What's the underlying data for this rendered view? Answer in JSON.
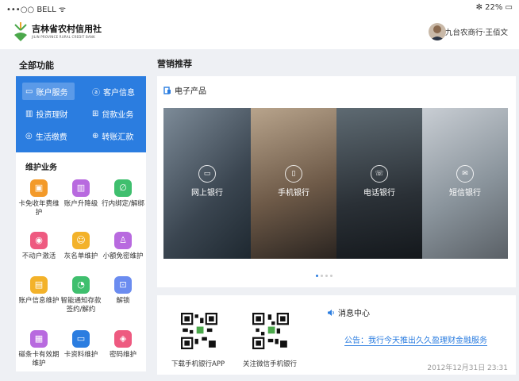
{
  "status": {
    "carrier": "•••○○ BELL ᯤ",
    "battery": "✻ 22% ▭"
  },
  "header": {
    "logo_cn": "吉林省农村信用社",
    "logo_en": "JILIN PROVINCE RURAL CREDIT BANK",
    "user_name": "九台农商行·王佰文"
  },
  "sidebar": {
    "title": "全部功能",
    "quick": [
      {
        "label": "账户服务",
        "icon": "▭"
      },
      {
        "label": "客户信息",
        "icon": "ⓐ"
      },
      {
        "label": "投资理财",
        "icon": "▥"
      },
      {
        "label": "贷款业务",
        "icon": "⊞"
      },
      {
        "label": "生活缴费",
        "icon": "◎"
      },
      {
        "label": "转账汇款",
        "icon": "⊕"
      }
    ],
    "maint_title": "维护业务",
    "items": [
      {
        "label": "卡免收年费维护",
        "icon": "▣",
        "color": "#f39a2a"
      },
      {
        "label": "账户升降级",
        "icon": "▥",
        "color": "#b86adf"
      },
      {
        "label": "行内绑定/解绑",
        "icon": "∅",
        "color": "#3fbf6e"
      },
      {
        "label": "不动户激活",
        "icon": "◉",
        "color": "#ee5a80"
      },
      {
        "label": "灰名单维护",
        "icon": "☺",
        "color": "#f3b22a"
      },
      {
        "label": "小额免密维护",
        "icon": "♙",
        "color": "#b86adf"
      },
      {
        "label": "账户信息维护",
        "icon": "▤",
        "color": "#f3b22a"
      },
      {
        "label": "智能通知存款签约/解约",
        "icon": "◔",
        "color": "#3fbf6e"
      },
      {
        "label": "解锁",
        "icon": "⊡",
        "color": "#6b8cf0"
      },
      {
        "label": "磁条卡有效期维护",
        "icon": "▦",
        "color": "#b86adf"
      },
      {
        "label": "卡资料维护",
        "icon": "▭",
        "color": "#2b7de0"
      },
      {
        "label": "密码维护",
        "icon": "◈",
        "color": "#ee5a80"
      }
    ]
  },
  "main": {
    "title": "营销推荐",
    "ep_title": "电子产品",
    "banners": [
      {
        "label": "网上银行",
        "icon": "▭"
      },
      {
        "label": "手机银行",
        "icon": "▯"
      },
      {
        "label": "电话银行",
        "icon": "☏"
      },
      {
        "label": "短信银行",
        "icon": "✉"
      }
    ],
    "qr": [
      {
        "label": "下载手机银行APP"
      },
      {
        "label": "关注微信手机银行"
      }
    ],
    "msg": {
      "title": "消息中心",
      "text": "公告：我行今天推出久久盈理财金融服务",
      "date": "2012年12月31日 23:31"
    }
  }
}
